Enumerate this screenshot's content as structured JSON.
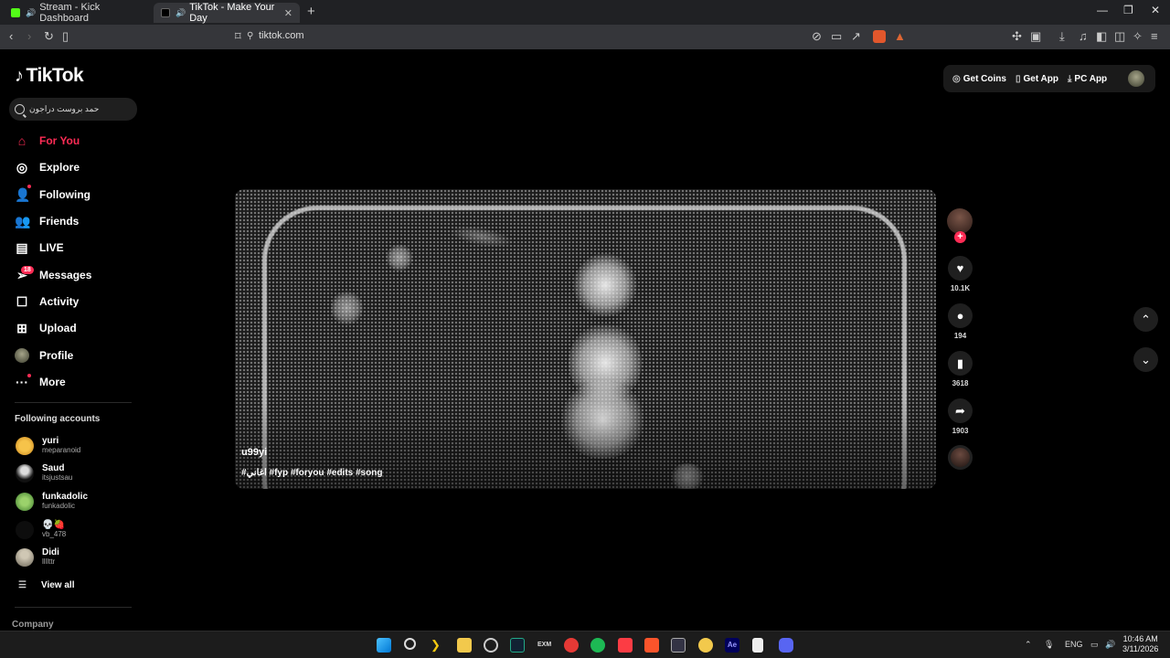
{
  "browser": {
    "tabs": [
      {
        "title": "Stream - Kick Dashboard",
        "favicon_color": "#53fc18"
      },
      {
        "title": "TikTok - Make Your Day",
        "favicon_color": "#000000"
      }
    ],
    "url": "tiktok.com"
  },
  "tiktok": {
    "logo_text": "TikTok",
    "search_placeholder": "حمد بروست دراجون",
    "header_actions": {
      "get_coins": "Get Coins",
      "get_app": "Get App",
      "pc_app": "PC App"
    },
    "nav": [
      {
        "label": "For You",
        "icon": "home-icon"
      },
      {
        "label": "Explore",
        "icon": "compass-icon"
      },
      {
        "label": "Following",
        "icon": "following-icon"
      },
      {
        "label": "Friends",
        "icon": "friends-icon"
      },
      {
        "label": "LIVE",
        "icon": "live-icon"
      },
      {
        "label": "Messages",
        "icon": "messages-icon",
        "badge": "18"
      },
      {
        "label": "Activity",
        "icon": "activity-icon"
      },
      {
        "label": "Upload",
        "icon": "upload-icon"
      },
      {
        "label": "Profile",
        "icon": "profile-avatar"
      },
      {
        "label": "More",
        "icon": "more-icon"
      }
    ],
    "following_title": "Following accounts",
    "following": [
      {
        "name": "yuri",
        "handle": "meparanoid"
      },
      {
        "name": "Saud",
        "handle": "itsjustsau"
      },
      {
        "name": "funkadolic",
        "handle": "funkadolic"
      },
      {
        "name": "💀🍓",
        "handle": "vb_478"
      },
      {
        "name": "Didi",
        "handle": "llllttr"
      }
    ],
    "view_all": "View all",
    "company": "Company",
    "video": {
      "author": "u99yi",
      "caption": "#اغاني #fyp #foryou #edits #song",
      "likes": "10.1K",
      "comments": "194",
      "saves": "3618",
      "shares": "1903"
    },
    "accent": "#fe2c55"
  },
  "taskbar": {
    "lang": "ENG",
    "time": "10:46 AM",
    "date": "3/11/2026"
  }
}
